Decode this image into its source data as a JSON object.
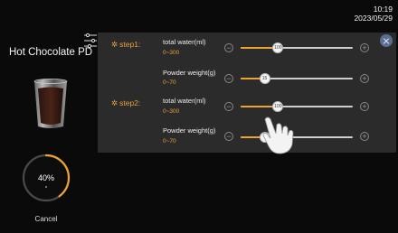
{
  "status": {
    "time": "10:19",
    "date": "2023/05/29"
  },
  "product": {
    "name": "Hot Chocolate PD"
  },
  "progress": {
    "percent": 40,
    "label": "40%"
  },
  "actions": {
    "cancel_label": "Cancel"
  },
  "colors": {
    "accent": "#f0a42f",
    "panel": "#2b2b2b",
    "close": "#5b6e92"
  },
  "icons": {
    "settings": "sliders-icon",
    "close": "close-icon",
    "minus": "minus-icon",
    "plus": "plus-icon",
    "step": "gear-icon"
  },
  "steps": [
    {
      "label": "step1:",
      "rows": [
        {
          "title": "total water(ml)",
          "range": "0~300",
          "value": 100,
          "max": 300,
          "value_label": "100"
        },
        {
          "title": "Powder weight(g)",
          "range": "0~70",
          "value": 15,
          "max": 70,
          "value_label": "15"
        }
      ]
    },
    {
      "label": "step2:",
      "rows": [
        {
          "title": "total water(ml)",
          "range": "0~300",
          "value": 100,
          "max": 300,
          "value_label": "100"
        },
        {
          "title": "Powder weight(g)",
          "range": "0~70",
          "value": 15,
          "max": 70,
          "value_label": ""
        }
      ]
    }
  ]
}
